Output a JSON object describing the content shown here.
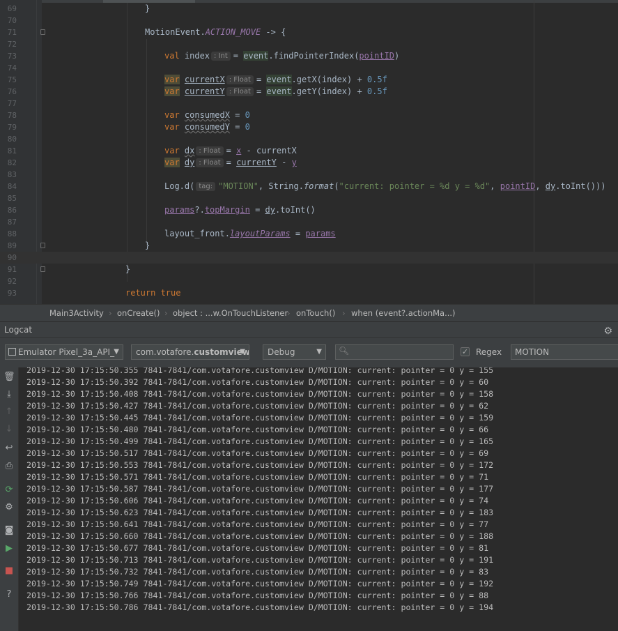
{
  "editor": {
    "lines": [
      {
        "n": "69",
        "t": [
          {
            "s": "}"
          }
        ]
      },
      {
        "n": "70",
        "t": []
      },
      {
        "n": "71",
        "t": [
          {
            "s": "MotionEvent."
          },
          {
            "s": "ACTION_MOVE",
            "c": "constf"
          },
          {
            "s": " -> {"
          }
        ]
      },
      {
        "n": "72",
        "t": []
      },
      {
        "n": "73",
        "t": [
          {
            "s": "val ",
            "c": "kw"
          },
          {
            "s": "index"
          },
          {
            "h": ": Int"
          },
          {
            "s": "= "
          },
          {
            "s": "event",
            "c": "hl-event"
          },
          {
            "s": ".findPointerIndex("
          },
          {
            "s": "pointID",
            "c": "prop under"
          },
          {
            "s": ")"
          }
        ]
      },
      {
        "n": "74",
        "t": []
      },
      {
        "n": "75",
        "t": [
          {
            "s": "var",
            "c": "kw hl-var"
          },
          {
            "s": " "
          },
          {
            "s": "currentX",
            "c": "under"
          },
          {
            "h": ": Float"
          },
          {
            "s": "= "
          },
          {
            "s": "event",
            "c": "hl-event"
          },
          {
            "s": ".getX(index) + "
          },
          {
            "s": "0.5f",
            "c": "num"
          }
        ]
      },
      {
        "n": "76",
        "t": [
          {
            "s": "var",
            "c": "kw hl-var"
          },
          {
            "s": " "
          },
          {
            "s": "currentY",
            "c": "under"
          },
          {
            "h": ": Float"
          },
          {
            "s": "= "
          },
          {
            "s": "event",
            "c": "hl-event"
          },
          {
            "s": ".getY(index) + "
          },
          {
            "s": "0.5f",
            "c": "num"
          }
        ]
      },
      {
        "n": "77",
        "t": []
      },
      {
        "n": "78",
        "t": [
          {
            "s": "var ",
            "c": "kw"
          },
          {
            "s": "consumedX",
            "c": "wavy"
          },
          {
            "s": " = "
          },
          {
            "s": "0",
            "c": "num"
          }
        ]
      },
      {
        "n": "79",
        "t": [
          {
            "s": "var ",
            "c": "kw"
          },
          {
            "s": "consumedY",
            "c": "wavy"
          },
          {
            "s": " = "
          },
          {
            "s": "0",
            "c": "num"
          }
        ]
      },
      {
        "n": "80",
        "t": []
      },
      {
        "n": "81",
        "t": [
          {
            "s": "var ",
            "c": "kw"
          },
          {
            "s": "dx",
            "c": "wavy"
          },
          {
            "h": ": Float"
          },
          {
            "s": "= "
          },
          {
            "s": "x",
            "c": "prop under"
          },
          {
            "s": " - currentX"
          }
        ]
      },
      {
        "n": "82",
        "t": [
          {
            "s": "var",
            "c": "kw hl-var"
          },
          {
            "s": " "
          },
          {
            "s": "dy",
            "c": "under"
          },
          {
            "h": ": Float"
          },
          {
            "s": "= "
          },
          {
            "s": "currentY",
            "c": "under"
          },
          {
            "s": " - "
          },
          {
            "s": "y",
            "c": "prop under"
          }
        ]
      },
      {
        "n": "83",
        "t": []
      },
      {
        "n": "84",
        "t": [
          {
            "s": "Log.d("
          },
          {
            "h": "tag:"
          },
          {
            "s": "\"MOTION\"",
            "c": "str"
          },
          {
            "s": ", String."
          },
          {
            "s": "format",
            "c": "it"
          },
          {
            "s": "("
          },
          {
            "s": "\"current: pointer = %d y = %d\"",
            "c": "str"
          },
          {
            "s": ", "
          },
          {
            "s": "pointID",
            "c": "prop under"
          },
          {
            "s": ", "
          },
          {
            "s": "dy",
            "c": "under"
          },
          {
            "s": ".toInt()))"
          }
        ]
      },
      {
        "n": "85",
        "t": []
      },
      {
        "n": "86",
        "t": [
          {
            "s": "params",
            "c": "prop under"
          },
          {
            "s": "?."
          },
          {
            "s": "topMargin",
            "c": "prop under"
          },
          {
            "s": " = "
          },
          {
            "s": "dy",
            "c": "under"
          },
          {
            "s": ".toInt()"
          }
        ]
      },
      {
        "n": "87",
        "t": []
      },
      {
        "n": "88",
        "t": [
          {
            "s": "layout_front."
          },
          {
            "s": "layoutParams",
            "c": "propi under"
          },
          {
            "s": " = "
          },
          {
            "s": "params",
            "c": "prop under"
          }
        ]
      },
      {
        "n": "89",
        "t": [
          {
            "s": "}"
          }
        ]
      },
      {
        "n": "90",
        "t": []
      },
      {
        "n": "91",
        "t": [
          {
            "s": "}"
          }
        ]
      },
      {
        "n": "92",
        "t": []
      },
      {
        "n": "93",
        "t": [
          {
            "s": "return true",
            "c": "kw"
          }
        ]
      }
    ]
  },
  "breadcrumb": [
    "Main3Activity",
    "onCreate()",
    "object : ...w.OnTouchListener",
    "onTouch()",
    "when (event?.actionMa...)"
  ],
  "logcat": {
    "title": "Logcat",
    "device": "Emulator Pixel_3a_API_",
    "package_prefix": "com.votafore.",
    "package_bold": "customview",
    "level": "Debug",
    "search_placeholder": "",
    "regex_label": "Regex",
    "regex_checked": true,
    "filter_value": "MOTION",
    "rows": [
      "2019-12-30 17:15:50.355 7841-7841/com.votafore.customview D/MOTION: current: pointer = 0 y = 155",
      "2019-12-30 17:15:50.392 7841-7841/com.votafore.customview D/MOTION: current: pointer = 0 y = 60",
      "2019-12-30 17:15:50.408 7841-7841/com.votafore.customview D/MOTION: current: pointer = 0 y = 158",
      "2019-12-30 17:15:50.427 7841-7841/com.votafore.customview D/MOTION: current: pointer = 0 y = 62",
      "2019-12-30 17:15:50.445 7841-7841/com.votafore.customview D/MOTION: current: pointer = 0 y = 159",
      "2019-12-30 17:15:50.480 7841-7841/com.votafore.customview D/MOTION: current: pointer = 0 y = 66",
      "2019-12-30 17:15:50.499 7841-7841/com.votafore.customview D/MOTION: current: pointer = 0 y = 165",
      "2019-12-30 17:15:50.517 7841-7841/com.votafore.customview D/MOTION: current: pointer = 0 y = 69",
      "2019-12-30 17:15:50.553 7841-7841/com.votafore.customview D/MOTION: current: pointer = 0 y = 172",
      "2019-12-30 17:15:50.571 7841-7841/com.votafore.customview D/MOTION: current: pointer = 0 y = 71",
      "2019-12-30 17:15:50.587 7841-7841/com.votafore.customview D/MOTION: current: pointer = 0 y = 177",
      "2019-12-30 17:15:50.606 7841-7841/com.votafore.customview D/MOTION: current: pointer = 0 y = 74",
      "2019-12-30 17:15:50.623 7841-7841/com.votafore.customview D/MOTION: current: pointer = 0 y = 183",
      "2019-12-30 17:15:50.641 7841-7841/com.votafore.customview D/MOTION: current: pointer = 0 y = 77",
      "2019-12-30 17:15:50.660 7841-7841/com.votafore.customview D/MOTION: current: pointer = 0 y = 188",
      "2019-12-30 17:15:50.677 7841-7841/com.votafore.customview D/MOTION: current: pointer = 0 y = 81",
      "2019-12-30 17:15:50.713 7841-7841/com.votafore.customview D/MOTION: current: pointer = 0 y = 191",
      "2019-12-30 17:15:50.732 7841-7841/com.votafore.customview D/MOTION: current: pointer = 0 y = 83",
      "2019-12-30 17:15:50.749 7841-7841/com.votafore.customview D/MOTION: current: pointer = 0 y = 192",
      "2019-12-30 17:15:50.766 7841-7841/com.votafore.customview D/MOTION: current: pointer = 0 y = 88",
      "2019-12-30 17:15:50.786 7841-7841/com.votafore.customview D/MOTION: current: pointer = 0 y = 194"
    ]
  },
  "icons": {
    "gear": "gear-icon",
    "side": [
      "trash-icon",
      "scroll-to-end-icon",
      "up-arrow-icon",
      "down-arrow-icon",
      "soft-wrap-icon",
      "print-icon",
      "restart-icon",
      "settings-icon",
      "screen-capture-icon",
      "screen-record-icon",
      "stop-icon",
      "help-icon"
    ]
  }
}
